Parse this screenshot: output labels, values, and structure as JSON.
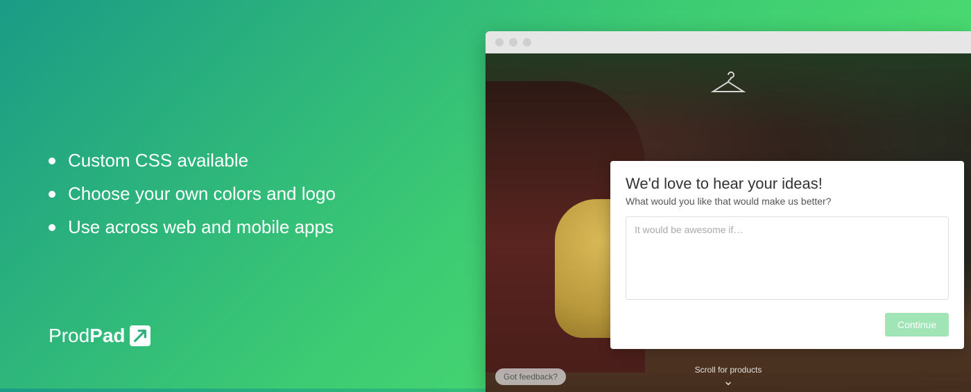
{
  "bullets": [
    "Custom CSS available",
    "Choose your own colors and logo",
    "Use across web and mobile apps"
  ],
  "brand": {
    "part1": "Prod",
    "part2": "Pad"
  },
  "hanger_icon": "hanger-icon",
  "feedback": {
    "title": "We'd love to hear your ideas!",
    "subtitle": "What would you like that would make us better?",
    "placeholder": "It would be awesome if…",
    "continue_label": "Continue"
  },
  "got_feedback_label": "Got feedback?",
  "scroll_hint": "Scroll for products"
}
